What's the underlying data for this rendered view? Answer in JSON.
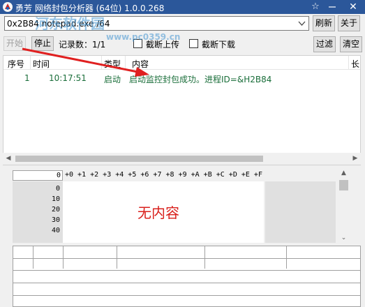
{
  "window": {
    "title": "勇芳  网络封包分析器 (64位) 1.0.0.268",
    "pin_glyph": "☆",
    "close_glyph": "✕"
  },
  "toolbar": {
    "process_value": "0x2B84 notepad.exe /64",
    "refresh_label": "刷新",
    "about_label": "关于",
    "start_label": "开始",
    "stop_label": "停止",
    "record_count": "记录数：1/1",
    "cut_upload_label": "截断上传",
    "cut_download_label": "截断下载",
    "filter_label": "过滤",
    "clear_label": "清空"
  },
  "log": {
    "columns": [
      "序号",
      "时间",
      "类型",
      "内容",
      "长"
    ],
    "rows": [
      {
        "index": "1",
        "time": "10:17:51",
        "type": "启动",
        "content": "启动监控封包成功。进程ID=&H2B84"
      }
    ]
  },
  "hex": {
    "offset_header": "0",
    "columns": "+0 +1 +2 +3 +4 +5 +6 +7 +8 +9 +A +B +C +D +E +F",
    "offsets": [
      "0",
      "10",
      "20",
      "30",
      "40"
    ],
    "empty_text": "无内容"
  },
  "watermark": {
    "text": "河东软件园",
    "url": "www.pc0359.cn"
  },
  "colors": {
    "titlebar": "#2b579a",
    "annotation_arrow": "#e02020",
    "empty_text": "#d9201c",
    "log_text": "#1a6e3a"
  }
}
